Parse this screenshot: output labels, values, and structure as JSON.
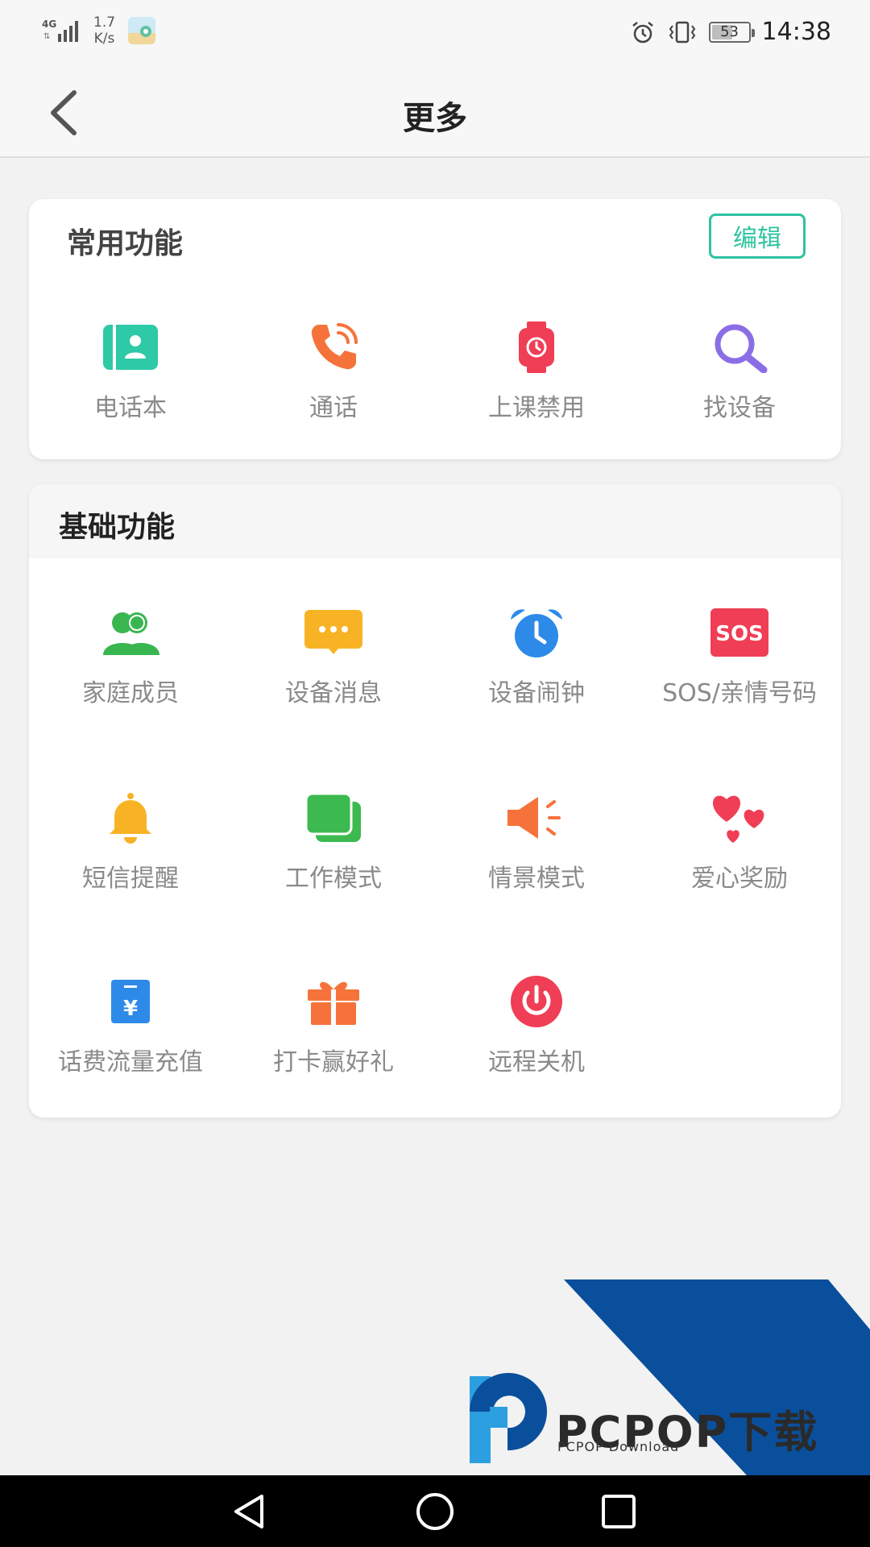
{
  "status_bar": {
    "network": "4G",
    "speed_value": "1.7",
    "speed_unit": "K/s",
    "battery": "53",
    "time": "14:38",
    "icons": [
      "signal-icon",
      "app-notification-icon",
      "alarm-icon",
      "vibrate-icon",
      "battery-icon"
    ]
  },
  "header": {
    "title": "更多",
    "back_icon": "chevron-left-icon"
  },
  "common": {
    "title": "常用功能",
    "edit_label": "编辑",
    "items": [
      {
        "label": "电话本",
        "icon": "contacts-book-icon",
        "color": "#2ec9a6"
      },
      {
        "label": "通话",
        "icon": "phone-call-icon",
        "color": "#f5733a"
      },
      {
        "label": "上课禁用",
        "icon": "watch-icon",
        "color": "#ef3e55"
      },
      {
        "label": "找设备",
        "icon": "search-icon",
        "color": "#8b6ee6"
      }
    ]
  },
  "basic": {
    "title": "基础功能",
    "items": [
      {
        "label": "家庭成员",
        "icon": "family-members-icon",
        "color": "#3ab650"
      },
      {
        "label": "设备消息",
        "icon": "message-bubble-icon",
        "color": "#f8b325"
      },
      {
        "label": "设备闹钟",
        "icon": "alarm-clock-icon",
        "color": "#2d8ae8"
      },
      {
        "label": "SOS/亲情号码",
        "icon": "sos-icon",
        "color": "#ef3e55"
      },
      {
        "label": "短信提醒",
        "icon": "bell-icon",
        "color": "#f8b325"
      },
      {
        "label": "工作模式",
        "icon": "layers-icon",
        "color": "#3cba4f"
      },
      {
        "label": "情景模式",
        "icon": "speaker-icon",
        "color": "#f5733a"
      },
      {
        "label": "爱心奖励",
        "icon": "hearts-icon",
        "color": "#ef3e55"
      },
      {
        "label": "话费流量充值",
        "icon": "recharge-icon",
        "color": "#2d8ae8"
      },
      {
        "label": "打卡赢好礼",
        "icon": "gift-icon",
        "color": "#f5733a"
      },
      {
        "label": "远程关机",
        "icon": "power-icon",
        "color": "#ef3e55"
      }
    ]
  },
  "watermark": {
    "brand": "PCPOP下载",
    "sub": "PCPOP Download",
    "colors": [
      "#0a4f9c",
      "#2c9fe0"
    ]
  },
  "nav_bar": {
    "icons": [
      "back-triangle-icon",
      "home-circle-icon",
      "recents-square-icon"
    ]
  }
}
